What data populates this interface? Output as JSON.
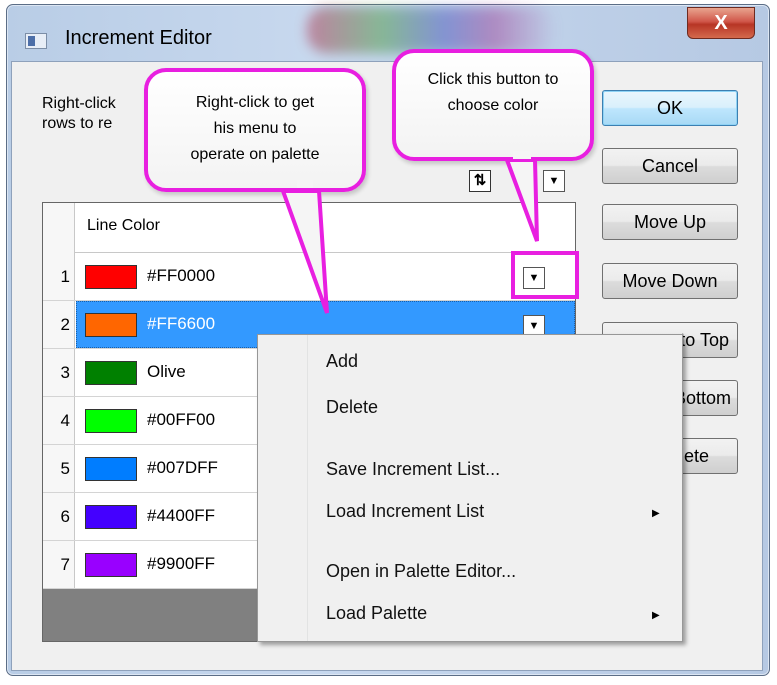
{
  "window": {
    "title": "Increment Editor",
    "close_glyph": "X"
  },
  "instructions": {
    "text": "Right-click to get his menu to operate on palette rows to reorder"
  },
  "instructions_visible": {
    "line1": "Right-click",
    "line1_tail": "nc",
    "line2": "rows to  re"
  },
  "buttons": {
    "ok": "OK",
    "cancel": "Cancel",
    "move_up": "Move Up",
    "move_down": "Move Down",
    "move_to_top": "to Top",
    "move_to_bottom": "Bottom",
    "delete": "ete"
  },
  "toolbar": {
    "sort_icon": "sort-icon",
    "sort_glyph": "⇅",
    "dropdown_glyph": "▼"
  },
  "grid": {
    "column_header": "Line Color",
    "selected_row": 2,
    "rows": [
      {
        "num": "1",
        "color": "#FF0000",
        "label": "#FF0000"
      },
      {
        "num": "2",
        "color": "#FF6600",
        "label": "#FF6600"
      },
      {
        "num": "3",
        "color": "#008000",
        "label": "Olive"
      },
      {
        "num": "4",
        "color": "#00FF00",
        "label": "#00FF00"
      },
      {
        "num": "5",
        "color": "#007DFF",
        "label": "#007DFF"
      },
      {
        "num": "6",
        "color": "#4400FF",
        "label": "#4400FF"
      },
      {
        "num": "7",
        "color": "#9900FF",
        "label": "#9900FF"
      }
    ]
  },
  "callouts": {
    "left": {
      "line1": "Right-click to get",
      "line2": "his menu to",
      "line3": "operate on palette"
    },
    "right": {
      "line1": "Click this button to",
      "line2": "choose color"
    },
    "accent_color": "#E81FE0"
  },
  "context_menu": {
    "items": [
      {
        "label": "Add",
        "submenu": false
      },
      {
        "label": "Delete",
        "submenu": false
      },
      {
        "label": "Save Increment List...",
        "submenu": false
      },
      {
        "label": "Load Increment List",
        "submenu": true
      },
      {
        "label": "Open in Palette Editor...",
        "submenu": false
      },
      {
        "label": "Load Palette",
        "submenu": true
      }
    ],
    "submenu_glyph": "▶"
  }
}
